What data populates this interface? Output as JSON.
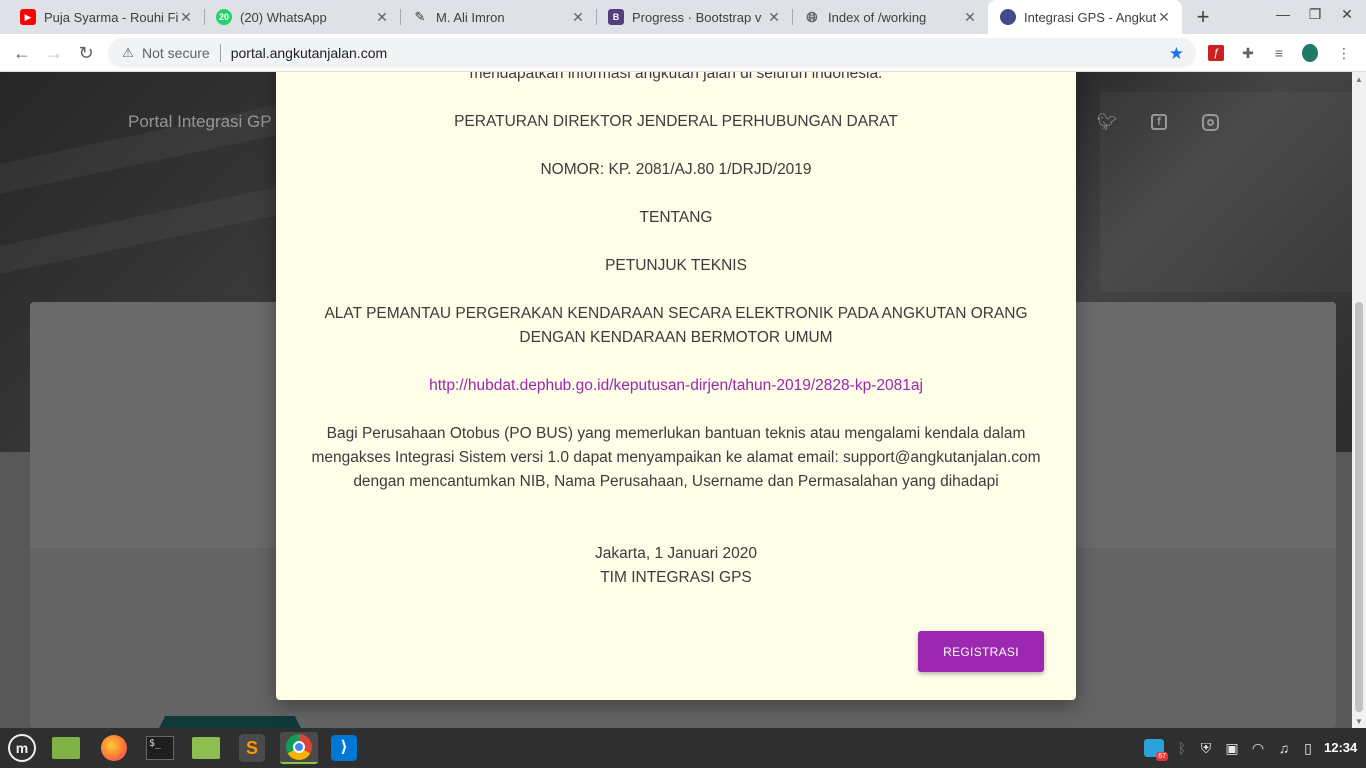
{
  "browser": {
    "tabs": [
      {
        "title": "Puja Syarma - Rouhi Fi",
        "icon": "youtube-icon",
        "active": false
      },
      {
        "title": "(20) WhatsApp",
        "icon": "whatsapp-icon",
        "badge": "20",
        "active": false
      },
      {
        "title": "M. Ali Imron",
        "icon": "pen-icon",
        "active": false
      },
      {
        "title": "Progress · Bootstrap v",
        "icon": "bootstrap-icon",
        "active": false
      },
      {
        "title": "Index of /working",
        "icon": "globe-icon",
        "active": false
      },
      {
        "title": "Integrasi GPS - Angkut",
        "icon": "site-logo-icon",
        "active": true
      }
    ],
    "security_label": "Not secure",
    "url": "portal.angkutanjalan.com",
    "colors": {
      "accent": "#9c27b0",
      "star": "#1a73e8"
    }
  },
  "page": {
    "brand": "Portal Integrasi GP",
    "social": [
      "twitter-icon",
      "facebook-icon",
      "instagram-icon"
    ]
  },
  "modal": {
    "intro_tail": "mendapatkan informasi angkutan jalan di seluruh indonesia.",
    "reg_title": "PERATURAN DIREKTOR JENDERAL PERHUBUNGAN DARAT",
    "reg_number": "NOMOR: KP. 2081/AJ.80 1/DRJD/2019",
    "about": "TENTANG",
    "guide": "PETUNJUK TEKNIS",
    "subject": "ALAT PEMANTAU PERGERAKAN KENDARAAN SECARA ELEKTRONIK PADA ANGKUTAN ORANG DENGAN KENDARAAN BERMOTOR UMUM",
    "link": "http://hubdat.dephub.go.id/keputusan-dirjen/tahun-2019/2828-kp-2081aj",
    "support": "Bagi Perusahaan Otobus (PO BUS) yang memerlukan bantuan teknis atau mengalami kendala dalam mengakses Integrasi Sistem versi 1.0 dapat menyampaikan ke alamat email: support@angkutanjalan.com dengan mencantumkan NIB, Nama Perusahaan, Username dan Permasalahan yang dihadapi",
    "place_date": "Jakarta, 1 Januari 2020",
    "signature": "TIM INTEGRASI GPS",
    "button_label": "REGISTRASI"
  },
  "taskbar": {
    "apps": [
      "mint-menu-icon",
      "files-icon",
      "firefox-icon",
      "terminal-icon",
      "folder-icon",
      "sublime-icon",
      "chrome-icon",
      "vscode-icon"
    ],
    "tray": [
      "telegram-icon",
      "bluetooth-icon",
      "shield-icon",
      "screen-icon",
      "wifi-icon",
      "music-icon",
      "battery-icon"
    ],
    "telegram_badge": "67",
    "clock": "12:34"
  }
}
